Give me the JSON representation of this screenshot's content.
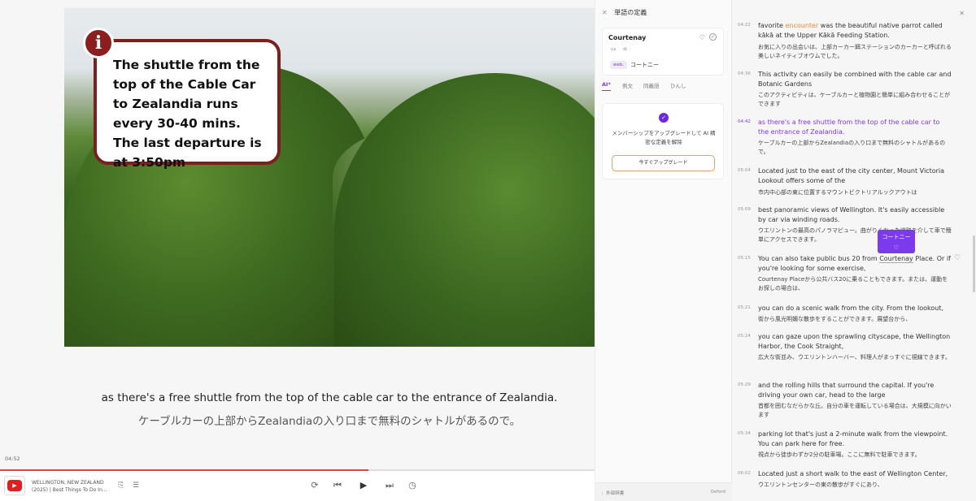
{
  "player": {
    "overlay_text": "The shuttle from the top of the Cable Car to Zealandia runs every 30-40 mins. The last departure is at 3:50pm",
    "overlay_icon": "info-icon",
    "overlay_glyph": "i",
    "subtitle_en": "as there's a free shuttle from the top of the cable car to the entrance of Zealandia.",
    "subtitle_ja": "ケーブルカーの上部からZealandiaの入り口まで無料のシャトルがあるので。",
    "current_time": "04:52",
    "progress_fraction": 0.62,
    "video_title_line1": "WELLINGTON, NEW ZEALAND",
    "video_title_line2": "(2025) | Best Things To Do In...",
    "icons": {
      "youtube": "youtube-icon",
      "bookmark": "bookmark-icon",
      "playlist": "playlist-icon",
      "loop": "loop-icon",
      "prev": "skip-previous-icon",
      "play": "play-icon",
      "next": "skip-next-icon",
      "speed": "speed-icon"
    }
  },
  "definition": {
    "header": "単語の定義",
    "word": "Courtenay",
    "pron_us": "us",
    "pron_uk": "ɪk",
    "source_tag": "web.",
    "translation": "コートニー",
    "tabs": [
      "AI*",
      "例文",
      "同義語",
      "ひんし"
    ],
    "active_tab": 0,
    "upgrade_message": "メンバーシップをアップグレードして AI 精密な定義を解除",
    "upgrade_button": "今すぐアップグレード",
    "footer_left": "⋮ 外部辞書",
    "footer_right": "Oxford"
  },
  "transcript": {
    "tooltip_text": "コートニー",
    "segments": [
      {
        "time": "04:22",
        "en_pre": "favorite ",
        "en_hl": "encounter",
        "en_post": " was the beautiful native parrot called kākā at the Upper Kākā Feeding Station.",
        "ja": "お気に入りの出会いは、上部カーカー餌ステーションのカーカーと呼ばれる美しいネイティブオウムでした。"
      },
      {
        "time": "04:36",
        "en": "This activity can easily be combined with the cable car and Botanic Gardens",
        "ja": "このアクティビティは、ケーブルカーと植物園と簡単に組み合わせることができます"
      },
      {
        "time": "04:42",
        "en": "as there's a free shuttle from the top of the cable car to the entrance of Zealandia.",
        "ja": "ケーブルカーの上部からZealandiaの入り口まで無料のシャトルがあるので。",
        "active": true
      },
      {
        "time": "05:04",
        "en": "Located just to the east of the city center, Mount Victoria Lookout offers some of the",
        "ja": "市内中心部の東に位置するマウントビクトリアルックアウトは"
      },
      {
        "time": "05:09",
        "en": "best panoramic views of Wellington. It's easily accessible by car via winding roads.",
        "ja": "ウエリントンの最高のパノラマビュー。曲がりくねった道路を介して車で簡単にアクセスできます。"
      },
      {
        "time": "05:15",
        "en_pre": "You can also take public bus 20 from ",
        "en_word": "Courtenay",
        "en_post": " Place. Or if you're looking for some exercise,",
        "ja": "Courtenay Placeから公共バス20に乗ることもできます。または、運動をお探しの場合は、"
      },
      {
        "time": "05:21",
        "en": "you can do a scenic walk from the city. From the lookout,",
        "ja": "街から風光明媚な散歩をすることができます。展望台から、"
      },
      {
        "time": "05:24",
        "en": "you can gaze upon the sprawling cityscape, the Wellington Harbor, the Cook Straight,",
        "ja": "広大な街並み、ウエリントンハーバー、料理人がまっすぐに視線できます。"
      },
      {
        "time": "05:29",
        "en": "and the rolling hills that surround the capital. If you're driving your own car, head to the large",
        "ja": "首都を囲むなだらかな丘。自分の車を運転している場合は、大規模に向かいます"
      },
      {
        "time": "05:34",
        "en": "parking lot that's just a 2-minute walk from the viewpoint. You can park here for free.",
        "ja": "視点から徒歩わずか2分の駐車場。ここに無料で駐車できます。"
      },
      {
        "time": "06:02",
        "en": "Located just a short walk to the east of Wellington Center,",
        "ja": "ウエリントンセンターの東の散歩がすぐにあり、"
      }
    ]
  }
}
